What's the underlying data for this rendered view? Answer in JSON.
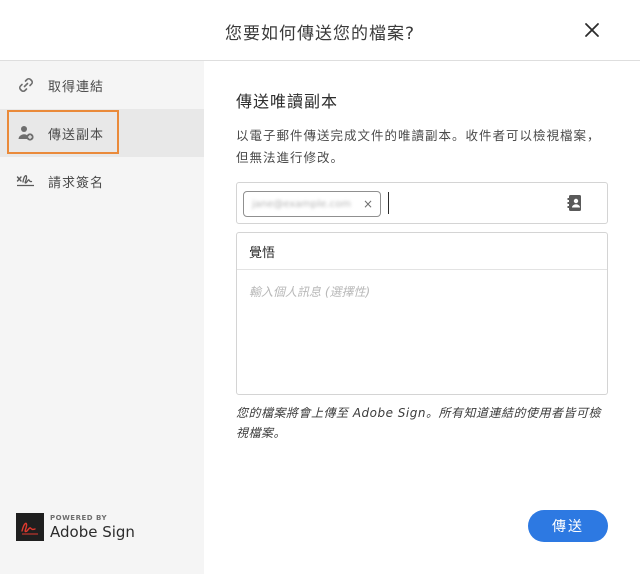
{
  "dialog": {
    "title": "您要如何傳送您的檔案?"
  },
  "sidebar": {
    "items": [
      {
        "label": "取得連結",
        "icon": "link-icon",
        "selected": false
      },
      {
        "label": "傳送副本",
        "icon": "add-person-icon",
        "selected": true
      },
      {
        "label": "請求簽名",
        "icon": "signature-icon",
        "selected": false
      }
    ],
    "brand": {
      "powered_by": "POWERED BY",
      "name": "Adobe Sign"
    }
  },
  "main": {
    "section_title": "傳送唯讀副本",
    "description": "以電子郵件傳送完成文件的唯讀副本。收件者可以檢視檔案，但無法進行修改。",
    "recipient": {
      "chip_text": "jane@example.com",
      "input_value": ""
    },
    "subject_value": "覺悟",
    "message_placeholder": "輸入個人訊息 (選擇性)",
    "notice": "您的檔案將會上傳至 Adobe Sign。所有知道連結的使用者皆可檢視檔案。",
    "send_label": "傳送"
  },
  "colors": {
    "accent_blue": "#2d79e2",
    "focus_orange": "#ea8a3a",
    "sidebar_bg": "#f5f5f5",
    "selected_bg": "#e8e8e8"
  }
}
